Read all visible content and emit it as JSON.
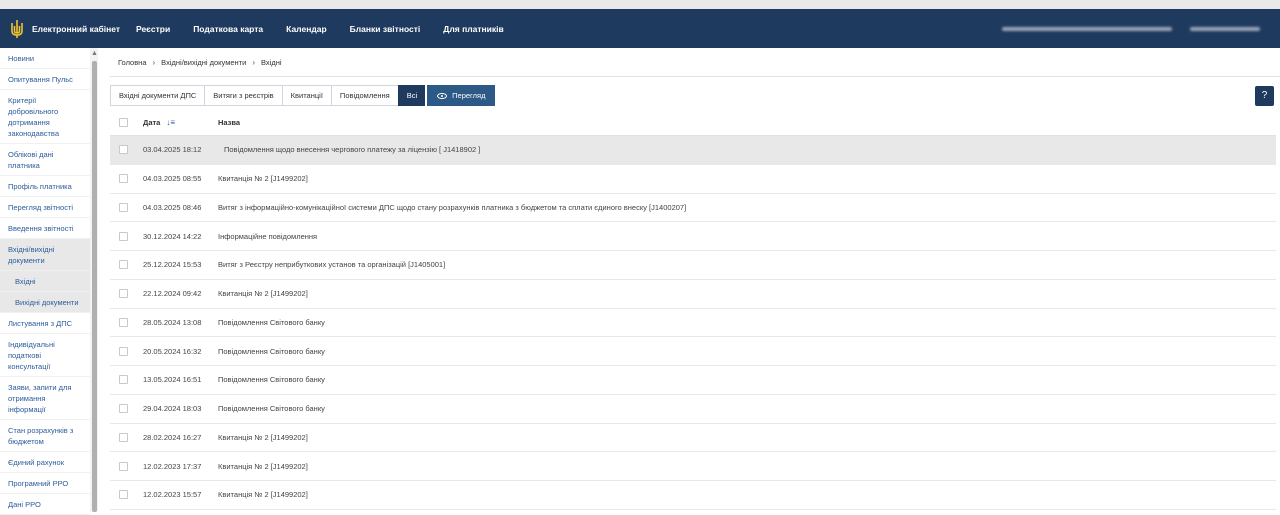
{
  "header": {
    "title": "Електронний кабінет",
    "nav": [
      "Реєстри",
      "Податкова карта",
      "Календар",
      "Бланки звітності",
      "Для платників"
    ]
  },
  "sidebar": {
    "items": [
      {
        "label": "Новини"
      },
      {
        "label": "Опитування Пульс"
      },
      {
        "label": "Критерії добровільного дотримання законодавства"
      },
      {
        "label": "Облікові дані платника"
      },
      {
        "label": "Профіль платника"
      },
      {
        "label": "Перегляд звітності"
      },
      {
        "label": "Введення звітності"
      },
      {
        "label": "Вхідні/вихідні документи"
      },
      {
        "label": "Вхідні"
      },
      {
        "label": "Вихідні документи"
      },
      {
        "label": "Листування з ДПС"
      },
      {
        "label": "Індивідуальні податкові консультації"
      },
      {
        "label": "Заяви, запити для отримання інформації"
      },
      {
        "label": "Стан розрахунків з бюджетом"
      },
      {
        "label": "Єдиний рахунок"
      },
      {
        "label": "Програмний РРО"
      },
      {
        "label": "Дані РРО"
      }
    ]
  },
  "breadcrumb": [
    "Головна",
    "Вхідні/вихідні документи",
    "Вхідні"
  ],
  "tabs": [
    "Вхідні документи ДПС",
    "Витяги з реєстрів",
    "Квитанції",
    "Повідомлення",
    "Всі"
  ],
  "view_button": "Перегляд",
  "help_label": "?",
  "table": {
    "headers": {
      "date": "Дата",
      "name": "Назва"
    },
    "rows": [
      {
        "date": "03.04.2025 18:12",
        "name": "Повідомлення щодо внесення чергового платежу за ліцензію    [ J1418902 ]"
      },
      {
        "date": "04.03.2025 08:55",
        "name": "Квитанція № 2 [J1499202]"
      },
      {
        "date": "04.03.2025 08:46",
        "name": "Витяг з інформаційно-комунікаційної системи ДПС щодо стану розрахунків платника з бюджетом та сплати єдиного внеску [J1400207]"
      },
      {
        "date": "30.12.2024 14:22",
        "name": "Інформаційне повідомлення"
      },
      {
        "date": "25.12.2024 15:53",
        "name": "Витяг з Реєстру неприбуткових установ та організацій [J1405001]"
      },
      {
        "date": "22.12.2024 09:42",
        "name": "Квитанція № 2 [J1499202]"
      },
      {
        "date": "28.05.2024 13:08",
        "name": "Повідомлення Світового банку"
      },
      {
        "date": "20.05.2024 16:32",
        "name": "Повідомлення Світового банку"
      },
      {
        "date": "13.05.2024 16:51",
        "name": "Повідомлення Світового банку"
      },
      {
        "date": "29.04.2024 18:03",
        "name": "Повідомлення Світового банку"
      },
      {
        "date": "28.02.2024 16:27",
        "name": "Квитанція № 2 [J1499202]"
      },
      {
        "date": "12.02.2023 17:37",
        "name": "Квитанція № 2 [J1499202]"
      },
      {
        "date": "12.02.2023 15:57",
        "name": "Квитанція № 2 [J1499202]"
      }
    ]
  },
  "colors": {
    "primary": "#1f3a5f",
    "link": "#2b5c9c",
    "selected_row": "#e8e8e8"
  }
}
